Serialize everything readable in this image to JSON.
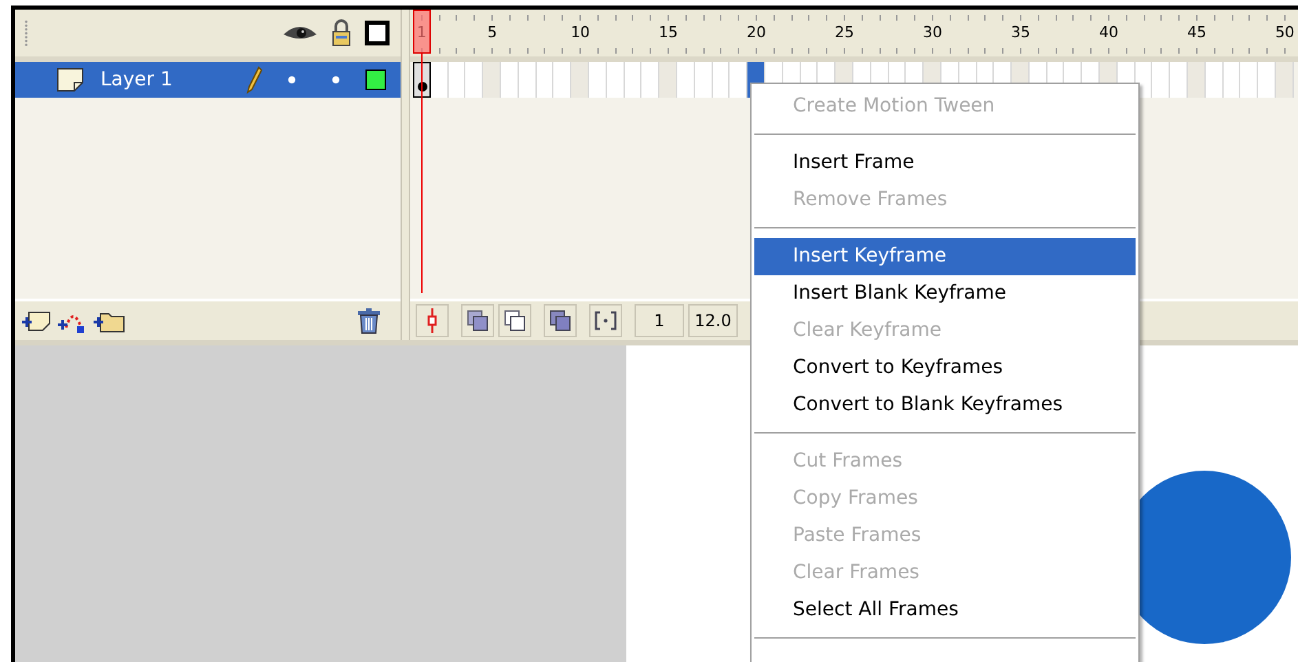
{
  "layers": [
    {
      "name": "Layer 1",
      "selected": true
    }
  ],
  "frames": [
    {
      "label": "1",
      "selected": false,
      "keyframe": true,
      "current": true
    },
    {
      "selected": false,
      "keyframe": false,
      "current": false
    },
    {
      "selected": false,
      "keyframe": false,
      "current": false
    },
    {
      "selected": false,
      "keyframe": false,
      "current": false
    },
    {
      "label": "5",
      "selected": false,
      "keyframe": false,
      "current": false
    },
    {
      "selected": false,
      "keyframe": false,
      "current": false
    },
    {
      "selected": false,
      "keyframe": false,
      "current": false
    },
    {
      "selected": false,
      "keyframe": false,
      "current": false
    },
    {
      "selected": false,
      "keyframe": false,
      "current": false
    },
    {
      "label": "10",
      "selected": false,
      "keyframe": false,
      "current": false
    },
    {
      "selected": false,
      "keyframe": false,
      "current": false
    },
    {
      "selected": false,
      "keyframe": false,
      "current": false
    },
    {
      "selected": false,
      "keyframe": false,
      "current": false
    },
    {
      "selected": false,
      "keyframe": false,
      "current": false
    },
    {
      "label": "15",
      "selected": false,
      "keyframe": false,
      "current": false
    },
    {
      "selected": false,
      "keyframe": false,
      "current": false
    },
    {
      "selected": false,
      "keyframe": false,
      "current": false
    },
    {
      "selected": false,
      "keyframe": false,
      "current": false
    },
    {
      "selected": false,
      "keyframe": false,
      "current": false
    },
    {
      "label": "20",
      "selected": true,
      "keyframe": false,
      "current": false
    },
    {
      "selected": false,
      "keyframe": false,
      "current": false
    },
    {
      "selected": false,
      "keyframe": false,
      "current": false
    },
    {
      "selected": false,
      "keyframe": false,
      "current": false
    },
    {
      "selected": false,
      "keyframe": false,
      "current": false
    },
    {
      "label": "25",
      "selected": false,
      "keyframe": false,
      "current": false
    },
    {
      "selected": false,
      "keyframe": false,
      "current": false
    },
    {
      "selected": false,
      "keyframe": false,
      "current": false
    },
    {
      "selected": false,
      "keyframe": false,
      "current": false
    },
    {
      "selected": false,
      "keyframe": false,
      "current": false
    },
    {
      "label": "30",
      "selected": false,
      "keyframe": false,
      "current": false
    },
    {
      "selected": false,
      "keyframe": false,
      "current": false
    },
    {
      "selected": false,
      "keyframe": false,
      "current": false
    },
    {
      "selected": false,
      "keyframe": false,
      "current": false
    },
    {
      "selected": false,
      "keyframe": false,
      "current": false
    },
    {
      "label": "35",
      "selected": false,
      "keyframe": false,
      "current": false
    },
    {
      "selected": false,
      "keyframe": false,
      "current": false
    },
    {
      "selected": false,
      "keyframe": false,
      "current": false
    },
    {
      "selected": false,
      "keyframe": false,
      "current": false
    },
    {
      "selected": false,
      "keyframe": false,
      "current": false
    },
    {
      "label": "40",
      "selected": false,
      "keyframe": false,
      "current": false
    },
    {
      "selected": false,
      "keyframe": false,
      "current": false
    },
    {
      "selected": false,
      "keyframe": false,
      "current": false
    },
    {
      "selected": false,
      "keyframe": false,
      "current": false
    },
    {
      "selected": false,
      "keyframe": false,
      "current": false
    },
    {
      "label": "45",
      "selected": false,
      "keyframe": false,
      "current": false
    },
    {
      "selected": false,
      "keyframe": false,
      "current": false
    },
    {
      "selected": false,
      "keyframe": false,
      "current": false
    },
    {
      "selected": false,
      "keyframe": false,
      "current": false
    },
    {
      "selected": false,
      "keyframe": false,
      "current": false
    },
    {
      "label": "50",
      "selected": false,
      "keyframe": false,
      "current": false
    }
  ],
  "timeline_status": {
    "current_frame": "1",
    "frame_rate": "12.0"
  },
  "context_menu": [
    {
      "kind": "item",
      "label": "Create Motion Tween",
      "disabled": true,
      "selected": false
    },
    {
      "kind": "separator"
    },
    {
      "kind": "item",
      "label": "Insert Frame",
      "disabled": false,
      "selected": false
    },
    {
      "kind": "item",
      "label": "Remove Frames",
      "disabled": true,
      "selected": false
    },
    {
      "kind": "separator"
    },
    {
      "kind": "item",
      "label": "Insert Keyframe",
      "disabled": false,
      "selected": true
    },
    {
      "kind": "item",
      "label": "Insert Blank Keyframe",
      "disabled": false,
      "selected": false
    },
    {
      "kind": "item",
      "label": "Clear Keyframe",
      "disabled": true,
      "selected": false
    },
    {
      "kind": "item",
      "label": "Convert to Keyframes",
      "disabled": false,
      "selected": false
    },
    {
      "kind": "item",
      "label": "Convert to Blank Keyframes",
      "disabled": false,
      "selected": false
    },
    {
      "kind": "separator"
    },
    {
      "kind": "item",
      "label": "Cut Frames",
      "disabled": true,
      "selected": false
    },
    {
      "kind": "item",
      "label": "Copy Frames",
      "disabled": true,
      "selected": false
    },
    {
      "kind": "item",
      "label": "Paste Frames",
      "disabled": true,
      "selected": false
    },
    {
      "kind": "item",
      "label": "Clear Frames",
      "disabled": true,
      "selected": false
    },
    {
      "kind": "item",
      "label": "Select All Frames",
      "disabled": false,
      "selected": false
    },
    {
      "kind": "separator"
    }
  ]
}
